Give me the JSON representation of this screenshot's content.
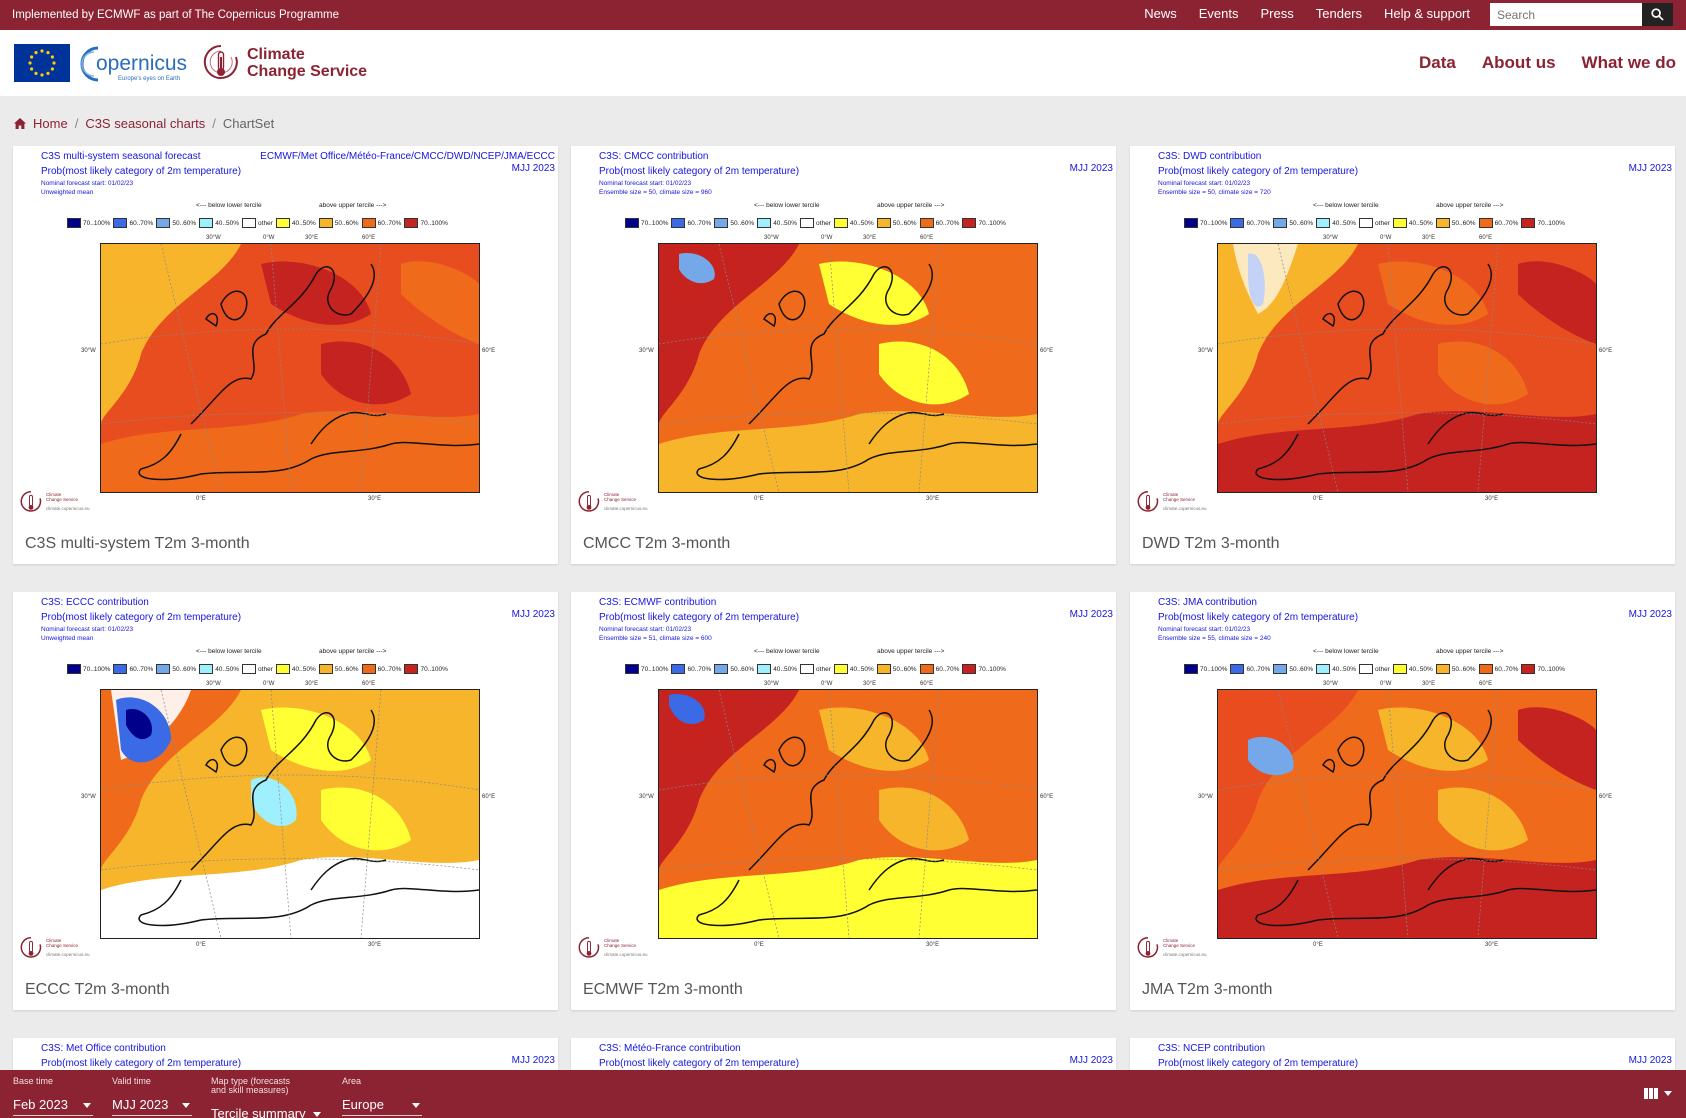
{
  "topbar": {
    "implemented_by": "Implemented by ECMWF as part of The Copernicus Programme",
    "nav": [
      "News",
      "Events",
      "Press",
      "Tenders",
      "Help & support"
    ],
    "search_placeholder": "Search"
  },
  "header": {
    "copernicus_name": "opernicus",
    "copernicus_tagline": "Europe's eyes on Earth",
    "c3s_line1": "Climate",
    "c3s_line2": "Change Service",
    "nav": [
      "Data",
      "About us",
      "What we do"
    ]
  },
  "breadcrumb": {
    "home": "Home",
    "parent": "C3S seasonal charts",
    "current": "ChartSet"
  },
  "chart_common": {
    "subtitle": "Prob(most likely category of 2m temperature)",
    "period": "MJJ 2023",
    "nominal_start": "Nominal forecast start: 01/02/23",
    "below_label": "<--- below lower tercile",
    "above_label": "above upper tercile --->",
    "legend": [
      {
        "label": "70..100%",
        "color": "#00008b"
      },
      {
        "label": "60..70%",
        "color": "#3a6ae6"
      },
      {
        "label": "50..60%",
        "color": "#74a8e8"
      },
      {
        "label": "40..50%",
        "color": "#9ef0ff"
      },
      {
        "label": "other",
        "color": "#ffffff"
      },
      {
        "label": "40..50%",
        "color": "#ffff33"
      },
      {
        "label": "50..60%",
        "color": "#f7b52c"
      },
      {
        "label": "60..70%",
        "color": "#f06a1c"
      },
      {
        "label": "70..100%",
        "color": "#c5231f"
      }
    ],
    "lon_top": [
      "30°W",
      "0°W",
      "30°E",
      "60°E"
    ],
    "lon_bottom": [
      "0°E",
      "30°E"
    ],
    "lat_left": "30°W",
    "lat_right": "60°E",
    "logo_line1": "Climate",
    "logo_line2": "Change Service",
    "logo_url": "climate.copernicus.eu"
  },
  "cards": [
    {
      "title": "C3S multi-system seasonal forecast",
      "systems": "ECMWF/Met Office/Météo-France/CMCC/DWD/NCEP/JMA/ECCC",
      "ensemble": "Unweighted mean",
      "caption": "C3S multi-system T2m 3-month"
    },
    {
      "title": "C3S: CMCC contribution",
      "systems": "",
      "ensemble": "Ensemble size = 50, climate size = 960",
      "caption": "CMCC T2m 3-month"
    },
    {
      "title": "C3S: DWD contribution",
      "systems": "",
      "ensemble": "Ensemble size = 50, climate size = 720",
      "caption": "DWD T2m 3-month"
    },
    {
      "title": "C3S: ECCC contribution",
      "systems": "",
      "ensemble": "Unweighted mean",
      "caption": "ECCC T2m 3-month"
    },
    {
      "title": "C3S: ECMWF contribution",
      "systems": "",
      "ensemble": "Ensemble size = 51, climate size = 600",
      "caption": "ECMWF T2m 3-month"
    },
    {
      "title": "C3S: JMA contribution",
      "systems": "",
      "ensemble": "Ensemble size = 55, climate size = 240",
      "caption": "JMA T2m 3-month"
    },
    {
      "title": "C3S: Met Office contribution",
      "systems": "",
      "ensemble": "",
      "caption": ""
    },
    {
      "title": "C3S: Météo-France contribution",
      "systems": "",
      "ensemble": "",
      "caption": ""
    },
    {
      "title": "C3S: NCEP contribution",
      "systems": "",
      "ensemble": "",
      "caption": ""
    }
  ],
  "bottombar": {
    "base_time": {
      "label": "Base time",
      "value": "Feb 2023"
    },
    "valid_time": {
      "label": "Valid time",
      "value": "MJJ 2023"
    },
    "map_type": {
      "label": "Map type (forecasts and skill measures)",
      "value": "Tercile summary"
    },
    "area": {
      "label": "Area",
      "value": "Europe"
    }
  },
  "colors": {
    "brand": "#8c2333",
    "chart_text": "#1515e0"
  }
}
